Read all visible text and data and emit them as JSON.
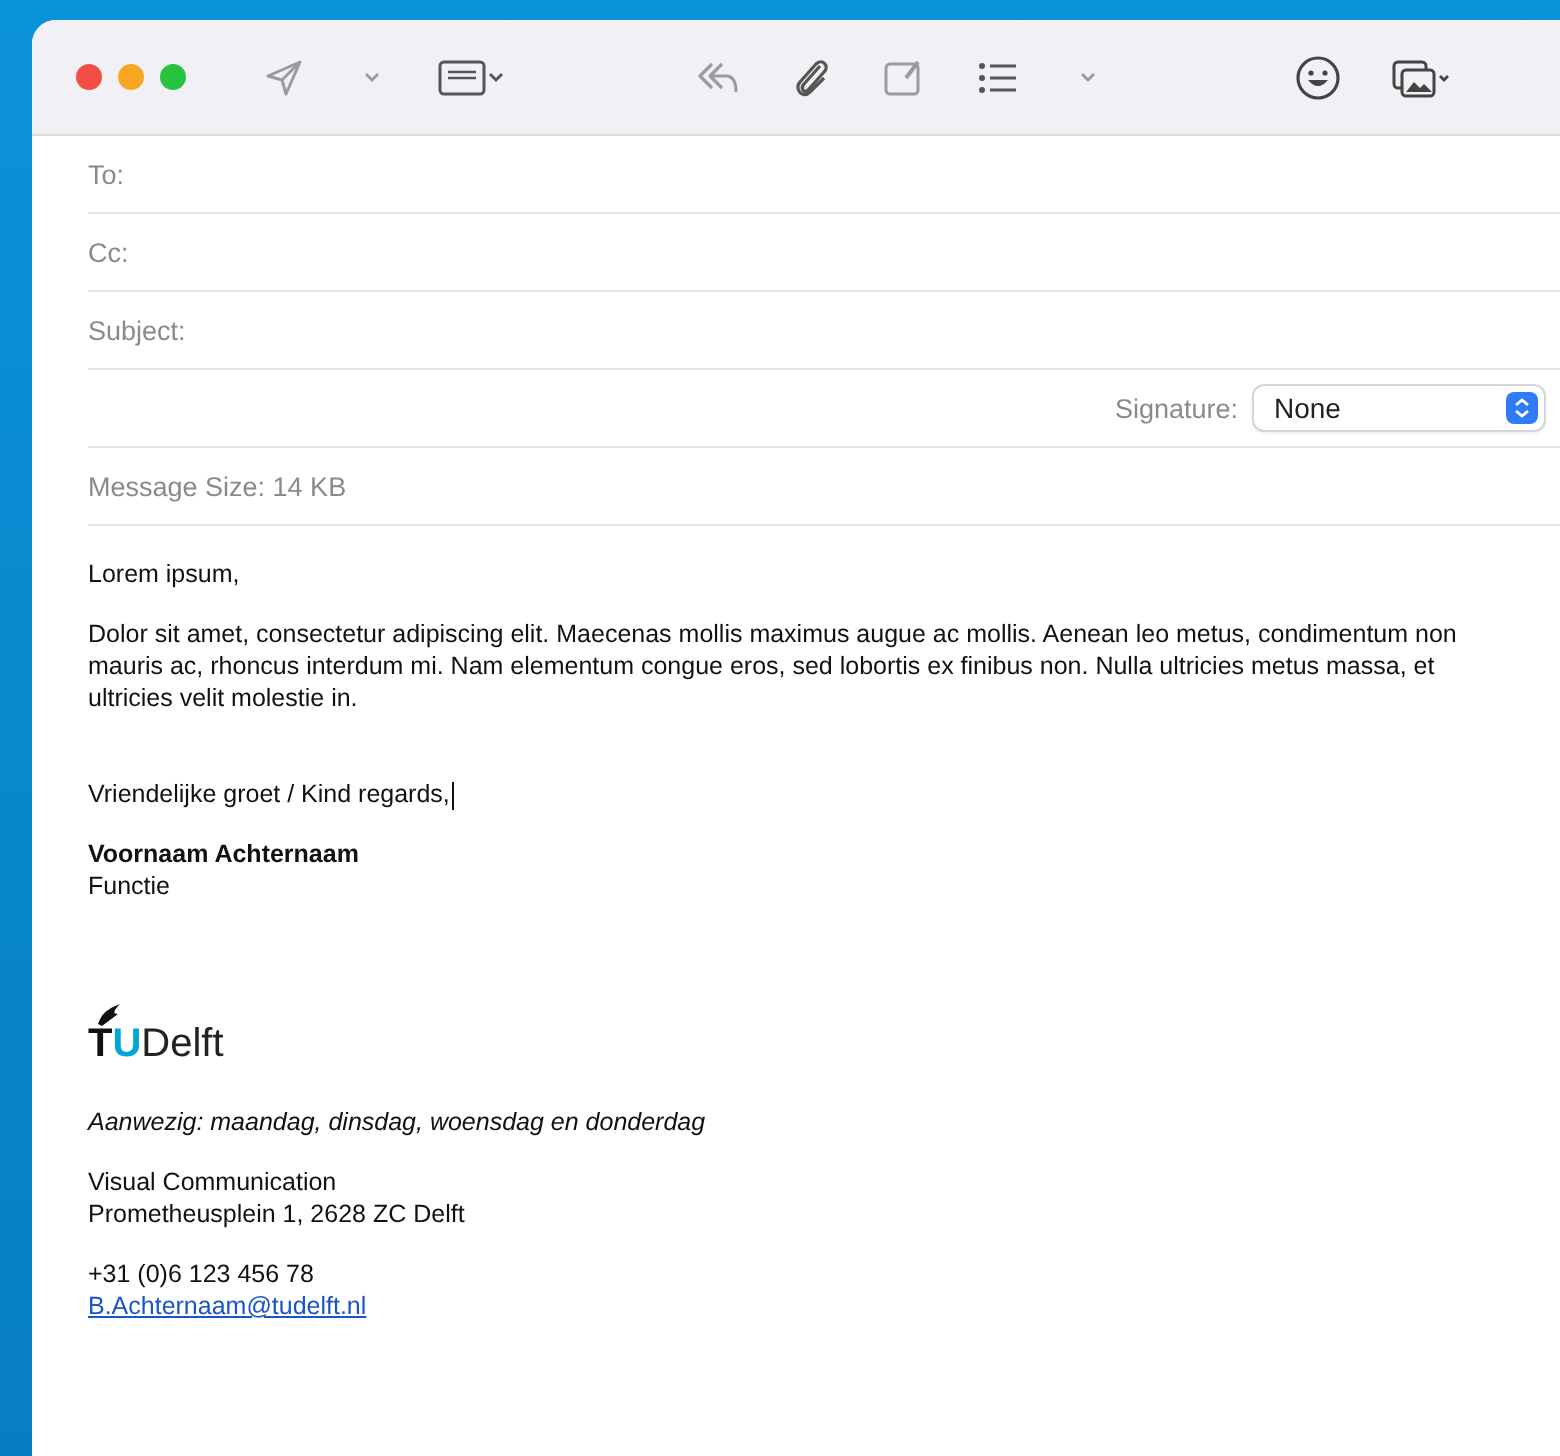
{
  "toolbar": {
    "buttons": [
      {
        "kind": "send"
      },
      {
        "kind": "chevron"
      },
      {
        "kind": "header"
      },
      {
        "kind": "reply"
      },
      {
        "kind": "attach"
      },
      {
        "kind": "markup"
      },
      {
        "kind": "list"
      },
      {
        "kind": "chevron"
      },
      {
        "kind": "emoji"
      },
      {
        "kind": "photo"
      }
    ]
  },
  "header_fields": [
    {
      "label": "To:"
    },
    {
      "label": "Cc:"
    },
    {
      "label": "Subject:"
    }
  ],
  "signature": {
    "label": "Signature:",
    "value": "None"
  },
  "message_size": "Message Size: 14 KB",
  "body": {
    "greeting": "Lorem ipsum,",
    "paragraph": "Dolor sit amet, consectetur adipiscing elit. Maecenas mollis maximus augue ac mollis. Aenean leo metus, condimentum non mauris ac, rhoncus interdum mi. Nam elementum congue eros, sed lobortis ex finibus non. Nulla ultricies metus massa, et ultricies velit molestie in.",
    "closing": "Vriendelijke groet / Kind regards,",
    "name": "Voornaam Achternaam",
    "role": "Functie",
    "logo": [
      "T",
      "U",
      "Delft"
    ],
    "presence": "Aanwezig: maandag, dinsdag, woensdag en donderdag",
    "department": "Visual Communication",
    "address": "Prometheusplein 1, 2628 ZC Delft",
    "phone": "+31 (0)6 123 456 78",
    "email": "B.Achternaam@tudelft.nl"
  }
}
